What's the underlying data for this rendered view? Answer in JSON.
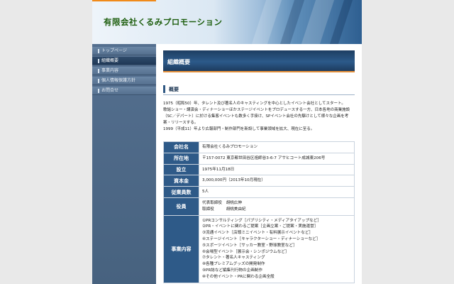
{
  "header": {
    "site_title": "有限会社くるみプロモーション"
  },
  "sidebar": {
    "items": [
      {
        "label": "トップページ",
        "active": false
      },
      {
        "label": "組織概要",
        "active": true
      },
      {
        "label": "事業内容",
        "active": false
      },
      {
        "label": "個人情報保護方針",
        "active": false
      },
      {
        "label": "お問合せ",
        "active": false
      }
    ]
  },
  "main": {
    "heading": "組織概要",
    "subheading": "概要",
    "intro": [
      "1975（昭和50）年、タレント及び著名人のキャスティングを中心としたイベント会社としてスタート。",
      "歌謡ショー・講演会・ディナーショーほかステージイベントをプロデュースする一方、日本各地の商業施設（SC／デパート）に於ける集客イベントも数多く手掛け、SPイベント会社の先駆けとして様々な企画を考案・リリースする。",
      "1999（平成11）年より広報部門・制作部門を新設して事業領域を拡大、現在に至る。"
    ],
    "company": {
      "name_label": "会社名",
      "name": "有限会社くるみプロモーション",
      "address_label": "所在地",
      "address": "〒157-0072 東京都世田谷区祖師谷3-6-7 アサヒコート成城東206号",
      "established_label": "設立",
      "established": "1975年11月18日",
      "capital_label": "資本金",
      "capital": "3,000,000円（2013年10月現在）",
      "employees_label": "従業員数",
      "employees": "5人",
      "officers_label": "役員",
      "officers": [
        "代表取締役　胡桃広伸",
        "取締役　　　胡桃美由紀"
      ],
      "business_label": "事業内容",
      "business": [
        "①PRコンサルティング［パブリシティ・メディアタイアップなど］",
        "②PR・イベントに関わるご提案［企画立案・ご提案・実施運営］",
        "③流通イベント［店頭ミニイベント・有料展示イベントなど］",
        "④ステージイベント［キャラクターショー・ディナーショーなど］",
        "⑤スポーツイベント［サッカー教室・野球教室など］",
        "⑥会場型イベント［展示会・シンポジウムなど］",
        "⑦タレント・著名人キャスティング",
        "⑧各種プレミアムグッズの開発制作",
        "⑨PR誌など編集刊行物の企画制作",
        "⑩その他イベント・PRに関わる企画全般"
      ]
    }
  },
  "colors": {
    "accent_orange": "#f08a1a",
    "navy": "#2e5a88",
    "title_green": "#1f5f10"
  }
}
